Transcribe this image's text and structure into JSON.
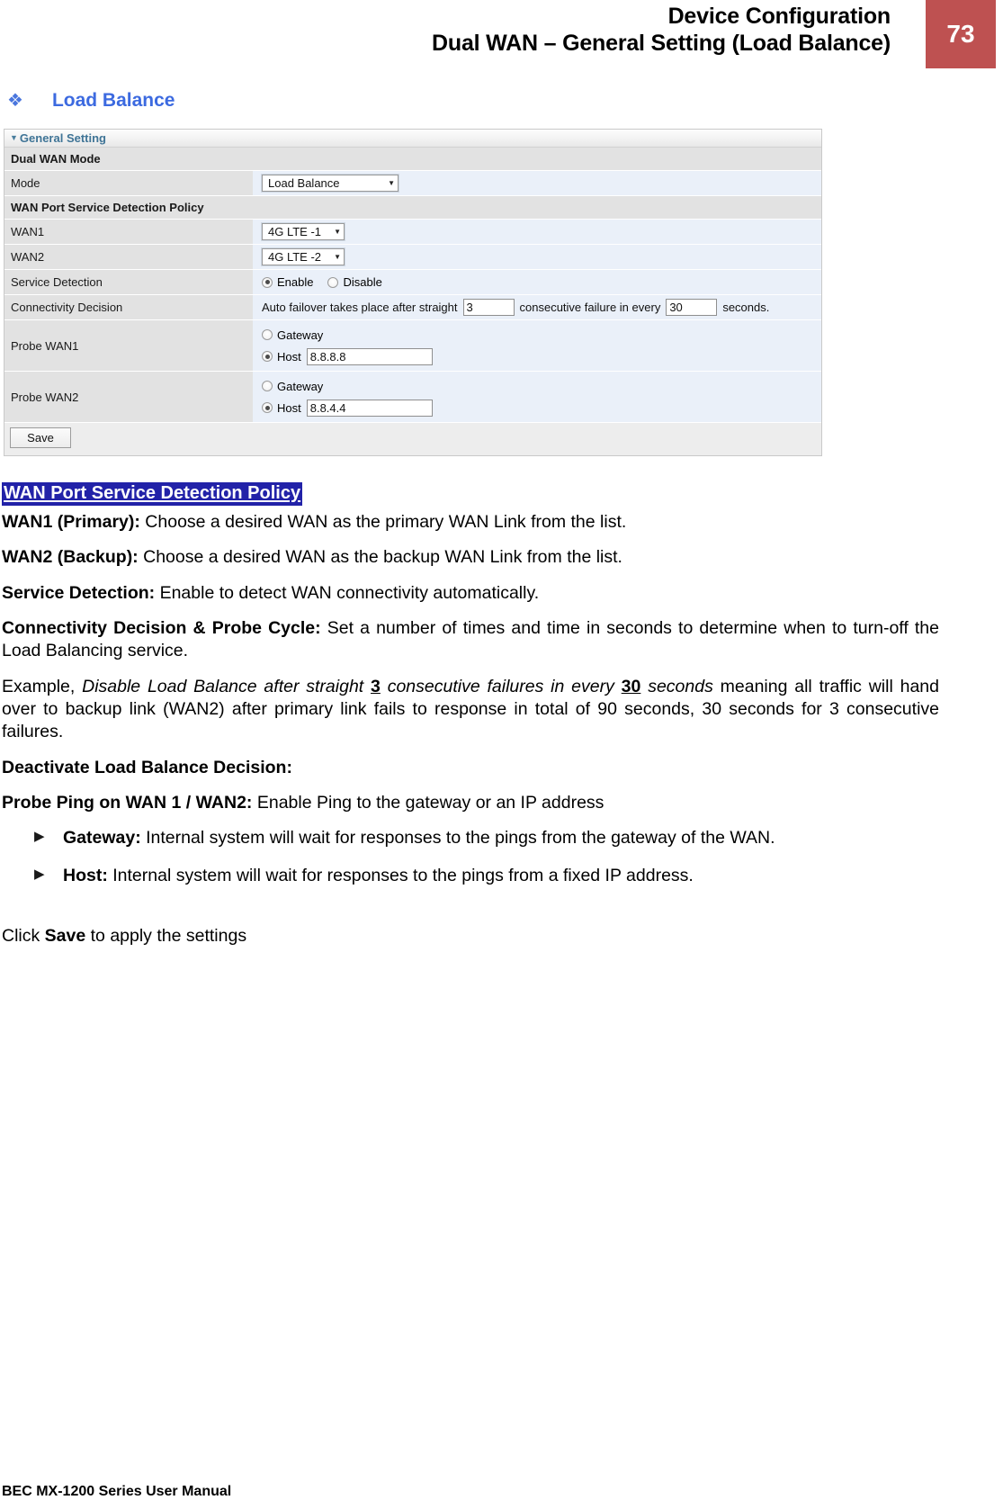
{
  "header": {
    "line1": "Device Configuration",
    "line2": "Dual WAN – General Setting (Load Balance)",
    "page_number": "73",
    "badge_color": "#be5151"
  },
  "section": {
    "bullet": "❖",
    "title": "Load Balance",
    "title_color": "#3c6ae0"
  },
  "ui_panel": {
    "titlebar": {
      "caret": "▼",
      "label": "General Setting"
    },
    "groups": {
      "dual_wan_mode": "Dual WAN Mode",
      "wan_port_service_detection_policy": "WAN Port Service Detection Policy"
    },
    "rows": {
      "mode": {
        "label": "Mode",
        "value": "Load Balance",
        "caret": "▼"
      },
      "wan1": {
        "label": "WAN1",
        "value": "4G LTE -1",
        "caret": "▼"
      },
      "wan2": {
        "label": "WAN2",
        "value": "4G LTE -2",
        "caret": "▼"
      },
      "service_detection": {
        "label": "Service Detection",
        "enable_label": "Enable",
        "disable_label": "Disable",
        "selected": "Enable"
      },
      "connectivity_decision": {
        "label": "Connectivity Decision",
        "text_before": "Auto failover takes place after straight",
        "failures_value": "3",
        "text_middle": "consecutive failure in every",
        "seconds_value": "30",
        "text_after": "seconds."
      },
      "probe_wan1": {
        "label": "Probe WAN1",
        "gateway_label": "Gateway",
        "host_label": "Host",
        "host_value": "8.8.8.8",
        "selected": "Host"
      },
      "probe_wan2": {
        "label": "Probe WAN2",
        "gateway_label": "Gateway",
        "host_label": "Host",
        "host_value": "8.8.4.4",
        "selected": "Host"
      }
    },
    "save_button": "Save"
  },
  "body": {
    "highlighted_heading": "WAN Port Service Detection Policy",
    "wan1_term": "WAN1 (Primary):",
    "wan1_desc": " Choose a desired WAN as the primary WAN Link from the list.",
    "wan2_term": "WAN2 (Backup):",
    "wan2_desc": " Choose a desired WAN as the backup WAN Link from the list.",
    "service_detection_term": "Service Detection:",
    "service_detection_desc": " Enable to detect WAN connectivity automatically.",
    "connectivity_term": "Connectivity Decision & Probe Cycle:",
    "connectivity_desc": " Set a number of times and time in seconds to determine when to turn-off the Load Balancing service.",
    "example_prefix": "Example, ",
    "example_italic_1": "Disable Load Balance after straight ",
    "example_bold_3": "3",
    "example_italic_2": " consecutive failures in every ",
    "example_bold_30": "30",
    "example_italic_3": " seconds",
    "example_suffix": " meaning all traffic will hand over to backup link (WAN2) after primary link fails to response in total of 90 seconds, 30 seconds for 3 consecutive failures.",
    "deactivate_heading": "Deactivate Load Balance Decision:",
    "probe_ping_term": "Probe Ping on WAN 1 / WAN2:",
    "probe_ping_desc": " Enable Ping to the gateway or an IP address",
    "bullets": [
      {
        "arrow": "▶",
        "term": "Gateway:",
        "desc": " Internal system will wait for responses to the pings from the gateway of the WAN."
      },
      {
        "arrow": "▶",
        "term": "Host:",
        "desc": " Internal system will wait for responses to the pings from a fixed IP address."
      }
    ],
    "click_prefix": "Click ",
    "click_bold": "Save",
    "click_suffix": " to apply the settings"
  },
  "footer": {
    "text": "BEC MX-1200 Series User Manual"
  }
}
